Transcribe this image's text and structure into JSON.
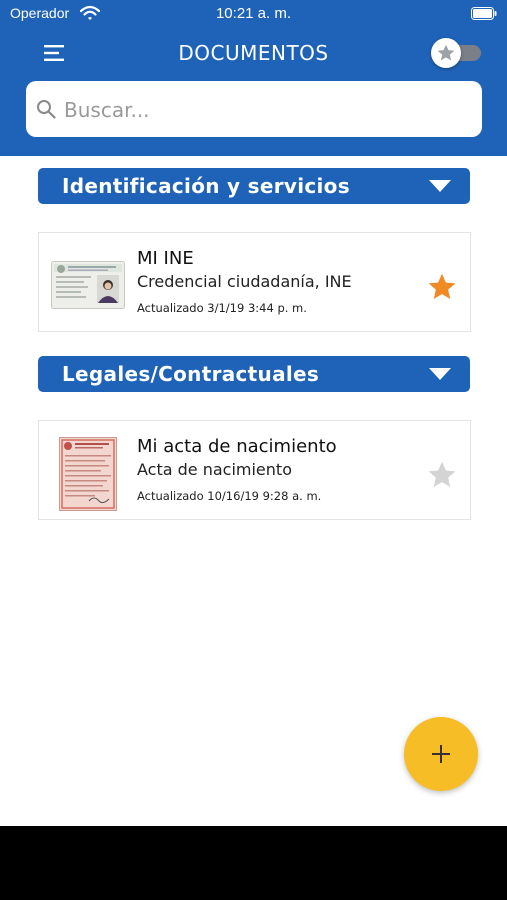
{
  "status_bar": {
    "carrier": "Operador",
    "time": "10:21 a. m."
  },
  "header": {
    "title": "DOCUMENTOS",
    "favorites_toggle_on": false
  },
  "search": {
    "placeholder": "Buscar...",
    "value": ""
  },
  "sections": [
    {
      "title": "Identificación y servicios",
      "documents": [
        {
          "name": "MI INE",
          "type": "Credencial ciudadanía, INE",
          "updated": "Actualizado 3/1/19 3:44 p. m.",
          "favorite": true,
          "thumbnail": "id-card-thumbnail"
        }
      ]
    },
    {
      "title": "Legales/Contractuales",
      "documents": [
        {
          "name": "Mi acta de nacimiento",
          "type": "Acta de nacimiento",
          "updated": "Actualizado 10/16/19 9:28 a. m.",
          "favorite": false,
          "thumbnail": "birth-certificate-thumbnail"
        }
      ]
    }
  ],
  "colors": {
    "primary": "#1e63b8",
    "fab": "#f6bd26",
    "star_active": "#f08a24",
    "star_inactive": "#d4d4d4"
  },
  "icons": [
    "wifi-icon",
    "battery-icon",
    "menu-icon",
    "star-icon",
    "search-icon",
    "chevron-down-icon",
    "plus-icon"
  ]
}
